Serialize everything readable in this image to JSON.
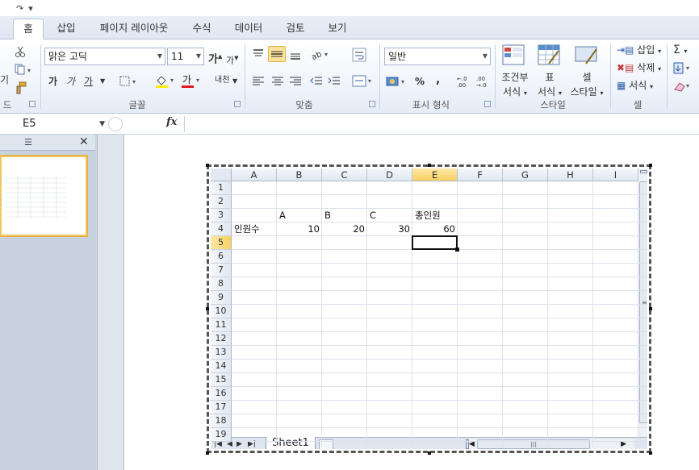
{
  "quick_access": {
    "redo": "↷",
    "customize": "▾"
  },
  "tabs": [
    "홈",
    "삽입",
    "페이지 레이아웃",
    "수식",
    "데이터",
    "검토",
    "보기"
  ],
  "active_tab": "홈",
  "ribbon": {
    "clipboard": {
      "label": "드",
      "paste_partial": "기"
    },
    "font": {
      "label": "글꼴",
      "font_name": "맑은 고딕",
      "font_size": "11",
      "grow": "가",
      "shrink": "가",
      "bold": "가",
      "italic": "가",
      "underline": "가",
      "font_color": "가",
      "phonetic": "내천"
    },
    "alignment": {
      "label": "맞춤"
    },
    "number": {
      "label": "표시 형식",
      "format": "일반",
      "percent": "%",
      "comma": ","
    },
    "styles": {
      "label": "스타일",
      "conditional": [
        "조건부",
        "서식"
      ],
      "table": [
        "표",
        "서식"
      ],
      "cell": [
        "셀",
        "스타일"
      ]
    },
    "cells": {
      "label": "셀",
      "insert": "삽입",
      "delete": "삭제",
      "format": "서식"
    },
    "editing": {
      "sum": "Σ"
    }
  },
  "formula_bar": {
    "name_box": "E5",
    "fx": "fx",
    "formula": ""
  },
  "sheet": {
    "columns": [
      "A",
      "B",
      "C",
      "D",
      "E",
      "F",
      "G",
      "H",
      "I"
    ],
    "selected_column": "E",
    "rows": [
      "1",
      "2",
      "3",
      "4",
      "5",
      "6",
      "7",
      "8",
      "9",
      "10",
      "11",
      "12",
      "13",
      "14",
      "15",
      "16",
      "17",
      "18",
      "19"
    ],
    "selected_row": "5",
    "cells": {
      "B3": "A",
      "C3": "B",
      "D3": "C",
      "E3": "총인원",
      "A4": "인원수",
      "B4": "10",
      "C4": "20",
      "D4": "30",
      "E4": "60"
    },
    "active_cell": "E5",
    "sheet_tab": "Sheet1",
    "nav": [
      "|◀",
      "◀",
      "▶",
      "▶|"
    ]
  }
}
